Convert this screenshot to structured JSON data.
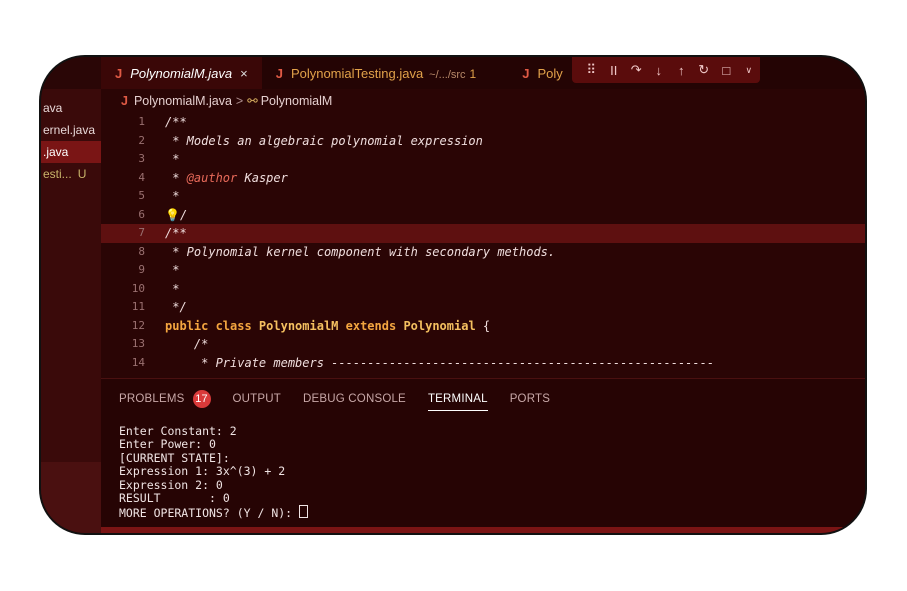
{
  "sidebar": {
    "items": [
      {
        "label": "ava",
        "state": "normal"
      },
      {
        "label": "ernel.java",
        "state": "normal"
      },
      {
        "label": ".java",
        "state": "active"
      },
      {
        "label": "esti...",
        "badge": "U",
        "state": "git"
      }
    ]
  },
  "tabs": [
    {
      "label": "PolynomialM.java",
      "close": "×"
    },
    {
      "label": "PolynomialTesting.java",
      "path": "~/.../src",
      "count": "1"
    },
    {
      "label": "Poly"
    }
  ],
  "debug_toolbar": [
    "drag-handle",
    "pause",
    "step-over",
    "step-into",
    "step-out",
    "restart",
    "stop",
    "more"
  ],
  "breadcrumb": {
    "file": "PolynomialM.java",
    "separator": ">",
    "symbol": "PolynomialM"
  },
  "editor": {
    "highlighted_line": 7,
    "lines": [
      {
        "n": "1",
        "text": "/**"
      },
      {
        "n": "2",
        "text": " * Models an algebraic polynomial expression"
      },
      {
        "n": "3",
        "text": " *"
      },
      {
        "n": "4",
        "pre": " * ",
        "tag": "@author",
        "post": " Kasper"
      },
      {
        "n": "5",
        "text": " *"
      },
      {
        "n": "6",
        "text": "/"
      },
      {
        "n": "7",
        "text": "/**"
      },
      {
        "n": "8",
        "text": " * Polynomial kernel component with secondary methods."
      },
      {
        "n": "9",
        "text": " *"
      },
      {
        "n": "10",
        "text": " *"
      },
      {
        "n": "11",
        "text": " */"
      },
      {
        "n": "12",
        "kw1": "public class ",
        "c1": "PolynomialM",
        "kw2": " extends ",
        "c2": "Polynomial",
        "post": " {"
      },
      {
        "n": "13",
        "text": "    /*"
      },
      {
        "n": "14",
        "text": "     * Private members -----------------------------------------------------"
      }
    ]
  },
  "panel": {
    "tabs": [
      {
        "label": "PROBLEMS",
        "badge": "17"
      },
      {
        "label": "OUTPUT"
      },
      {
        "label": "DEBUG CONSOLE"
      },
      {
        "label": "TERMINAL",
        "active": true
      },
      {
        "label": "PORTS"
      }
    ],
    "terminal_lines": [
      "Enter Constant: 2",
      "Enter Power: 0",
      "[CURRENT STATE]:",
      "Expression 1: 3x^(3) + 2",
      "Expression 2: 0",
      "RESULT       : 0",
      "MORE OPERATIONS? (Y / N): "
    ]
  },
  "colors": {
    "background": "#2a0505",
    "accent": "#7a1515",
    "keyword": "#f4a640"
  }
}
